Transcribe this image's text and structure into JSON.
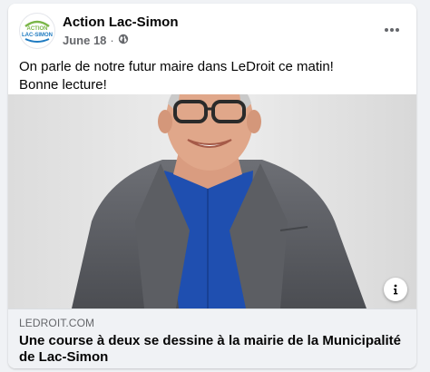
{
  "post": {
    "page_name": "Action Lac-Simon",
    "date": "June 18",
    "separator": "·",
    "privacy_icon": "globe-icon",
    "more_icon": "more-options-icon",
    "avatar_logo": {
      "line1": "ACTION",
      "line2": "LAC-SIMON"
    },
    "text_lines": [
      "On parle de notre futur maire dans LeDroit ce matin!",
      "Bonne lecture!"
    ]
  },
  "link": {
    "domain": "LEDROIT.COM",
    "headline": "Une course à deux se dessine à la mairie de la Municipalité de Lac-Simon",
    "info_icon": "info-icon"
  },
  "colors": {
    "card_bg": "#ffffff",
    "page_bg": "#f0f2f5",
    "text_primary": "#050505",
    "text_secondary": "#65676b",
    "logo_green": "#7ab648",
    "logo_blue": "#1f7bc1"
  }
}
